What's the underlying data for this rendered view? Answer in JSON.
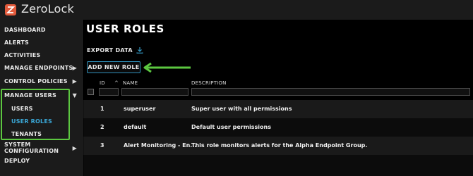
{
  "app": {
    "brand": "ZeroLock"
  },
  "sidebar": {
    "items": [
      {
        "label": "DASHBOARD"
      },
      {
        "label": "ALERTS"
      },
      {
        "label": "ACTIVITIES"
      },
      {
        "label": "MANAGE ENDPOINTS"
      },
      {
        "label": "CONTROL POLICIES"
      },
      {
        "label": "MANAGE USERS"
      },
      {
        "label": "USERS"
      },
      {
        "label": "USER ROLES"
      },
      {
        "label": "TENANTS"
      },
      {
        "label": "SYSTEM CONFIGURATION"
      },
      {
        "label": "DEPLOY"
      }
    ]
  },
  "main": {
    "title": "USER ROLES",
    "export_label": "EXPORT DATA",
    "add_button_label": "ADD NEW ROLE",
    "columns": {
      "id": "ID",
      "name": "NAME",
      "description": "DESCRIPTION"
    },
    "rows": [
      {
        "id": "1",
        "name": "superuser",
        "description": "Super user with all permissions"
      },
      {
        "id": "2",
        "name": "default",
        "description": "Default user permissions"
      },
      {
        "id": "3",
        "name": "Alert Monitoring - En...",
        "description": "This role monitors alerts for the Alpha Endpoint Group."
      }
    ]
  },
  "colors": {
    "accent": "#3aa7d6",
    "highlight": "#5cc740",
    "sidebar_bg": "#1b1b1b"
  }
}
